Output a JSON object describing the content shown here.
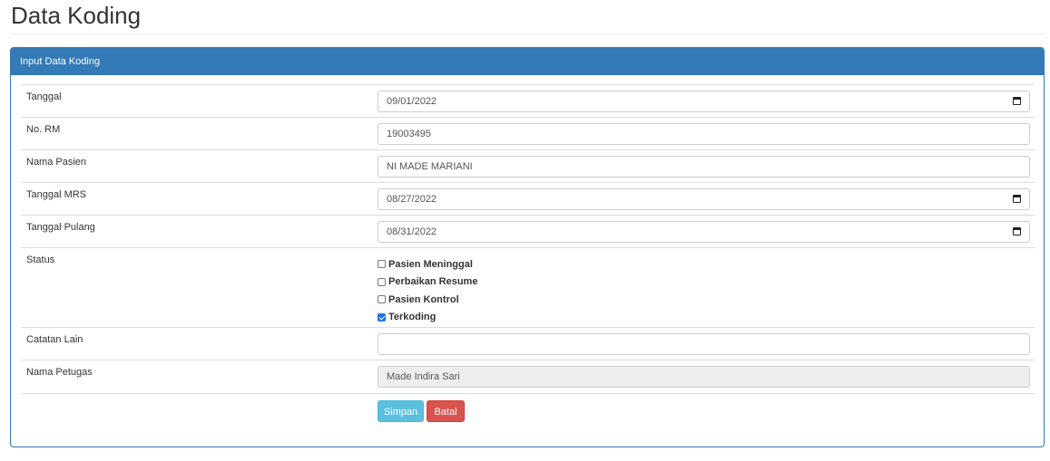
{
  "page": {
    "title": "Data Koding"
  },
  "panel": {
    "heading": "Input Data Koding"
  },
  "form": {
    "tanggal": {
      "label": "Tanggal",
      "value": "09/01/2022"
    },
    "no_rm": {
      "label": "No. RM",
      "value": "19003495"
    },
    "nama_pasien": {
      "label": "Nama Pasien",
      "value": "NI MADE MARIANI"
    },
    "tanggal_mrs": {
      "label": "Tanggal MRS",
      "value": "08/27/2022"
    },
    "tanggal_pulang": {
      "label": "Tanggal Pulang",
      "value": "08/31/2022"
    },
    "status": {
      "label": "Status",
      "options": [
        {
          "label": "Pasien Meninggal",
          "checked": false
        },
        {
          "label": "Perbaikan Resume",
          "checked": false
        },
        {
          "label": "Pasien Kontrol",
          "checked": false
        },
        {
          "label": "Terkoding",
          "checked": true
        }
      ]
    },
    "catatan_lain": {
      "label": "Catatan Lain",
      "value": ""
    },
    "nama_petugas": {
      "label": "Nama Petugas",
      "value": "Made Indira Sari"
    }
  },
  "buttons": {
    "save_label": "Simpan",
    "cancel_label": "Batal"
  },
  "colors": {
    "primary": "#337ab7",
    "info": "#5bc0de",
    "danger": "#d9534f",
    "checkbox_checked": "#1e73e8"
  }
}
